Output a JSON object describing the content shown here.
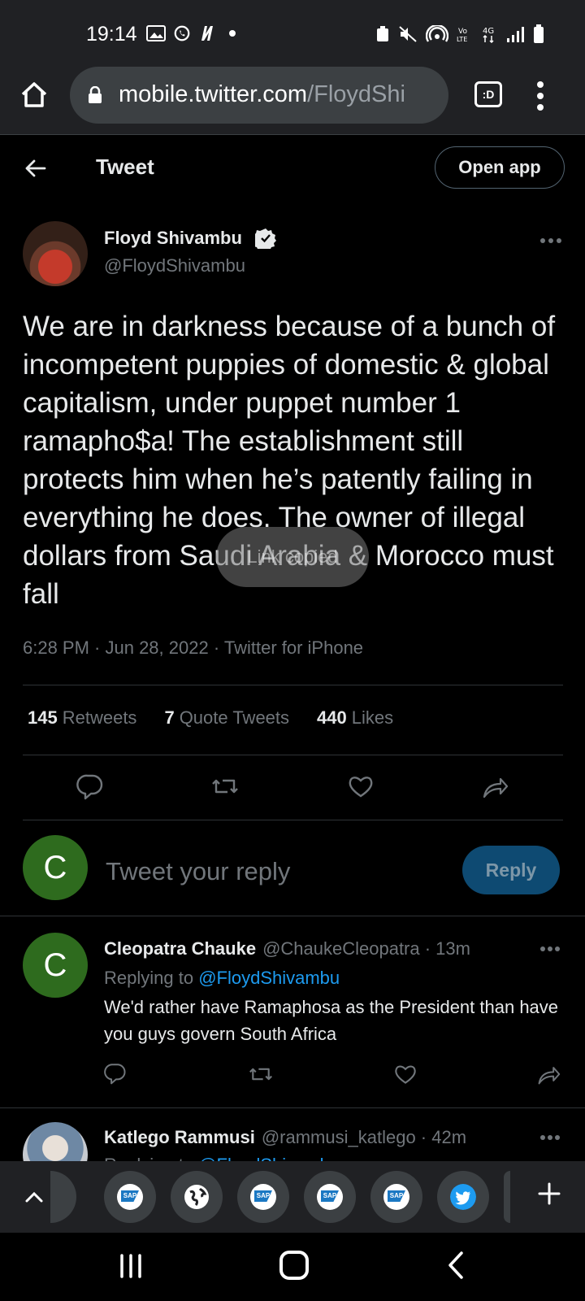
{
  "status_bar": {
    "time": "19:14"
  },
  "browser": {
    "url_main": "mobile.twitter.com",
    "url_path": "/FloydShi",
    "tabs_label": ":D"
  },
  "header": {
    "title": "Tweet",
    "open_app_label": "Open app"
  },
  "tweet": {
    "author_name": "Floyd Shivambu",
    "author_handle": "@FloydShivambu",
    "text": "We are in darkness because of a bunch of incompetent puppies of domestic & global capitalism, under puppet number 1 ramapho$a! The establishment still protects him when he’s patently failing in everything he does. The owner of illegal dollars from Saudi Arabia & Morocco must fall",
    "meta": "6:28 PM · Jun 28, 2022 · Twitter for iPhone",
    "retweets_count": "145",
    "retweets_label": "Retweets",
    "quotes_count": "7",
    "quotes_label": "Quote Tweets",
    "likes_count": "440",
    "likes_label": "Likes",
    "toast": "Link copied"
  },
  "compose": {
    "avatar_letter": "C",
    "placeholder": "Tweet your reply",
    "reply_label": "Reply"
  },
  "replies": [
    {
      "avatar_letter": "C",
      "name": "Cleopatra Chauke",
      "handle_time": "@ChaukeCleopatra · 13m",
      "replying_prefix": "Replying to ",
      "replying_to": "@FloydShivambu",
      "text": "We'd rather have Ramaphosa as the President than have you guys govern South Africa"
    },
    {
      "name": "Katlego Rammusi",
      "handle_time": "@rammusi_katlego · 42m",
      "replying_prefix": "Replying to ",
      "replying_to": "@FloydShivambu"
    }
  ],
  "colors": {
    "background": "#000000",
    "accent_blue": "#1d9bf0",
    "muted_text": "#71767b",
    "avatar_green": "#2e6b1e",
    "reply_button": "#0e4a72"
  },
  "icons": [
    "home-icon",
    "lock-icon",
    "more-vert-icon",
    "back-arrow-icon",
    "verified-badge-icon",
    "more-horiz-icon",
    "reply-icon",
    "retweet-icon",
    "like-icon",
    "share-icon",
    "chevron-up-icon",
    "sap-icon",
    "globe-icon",
    "twitter-icon",
    "plus-icon"
  ]
}
